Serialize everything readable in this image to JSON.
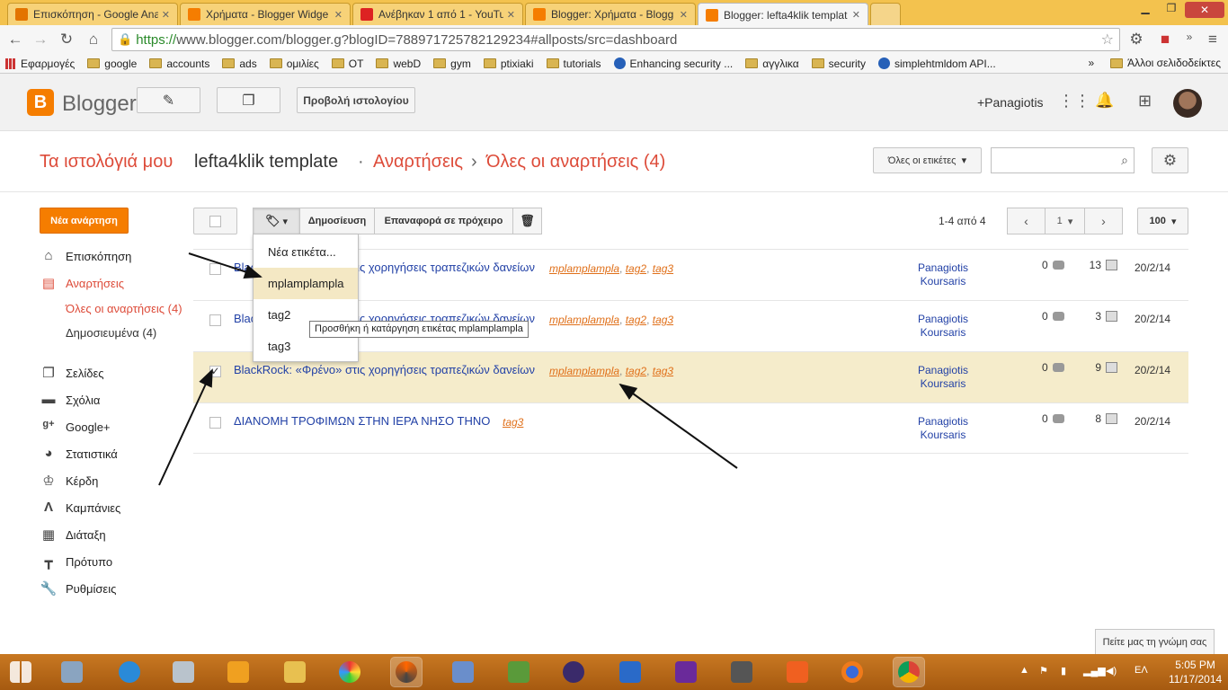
{
  "browser": {
    "tabs": [
      {
        "label": "Επισκόπηση - Google Ana",
        "color": "#e37400"
      },
      {
        "label": "Χρήματα - Blogger Widge",
        "color": "#f57d00"
      },
      {
        "label": "Ανέβηκαν 1 από 1 - YouTu",
        "color": "#d22"
      },
      {
        "label": "Blogger: Χρήματα - Blogg",
        "color": "#f57d00"
      },
      {
        "label": "Blogger: lefta4klik templat",
        "color": "#f57d00"
      }
    ],
    "url_https": "https://",
    "url_rest": "www.blogger.com/blogger.g?blogID=788971725782129234#allposts/src=dashboard",
    "bookmarks": [
      "Εφαρμογές",
      "google",
      "accounts",
      "ads",
      "ομιλίες",
      "OT",
      "webD",
      "gym",
      "ptixiaki",
      "tutorials",
      "Enhancing security ...",
      "αγγλικα",
      "security",
      "simplehtmldom API..."
    ],
    "bookmarks_more": "»",
    "other_bookmarks": "Άλλοι σελιδοδείκτες"
  },
  "header": {
    "brand": "Blogger",
    "view_blog": "Προβολή ιστολογίου",
    "user": "+Panagiotis"
  },
  "breadcrumb": {
    "my_blogs": "Τα ιστολόγιά μου",
    "blog": "lefta4klik template",
    "dot": "·",
    "posts": "Αναρτήσεις",
    "arrow": "›",
    "all_posts": "Όλες οι αναρτήσεις (4)"
  },
  "filter": {
    "labels": "Όλες οι ετικέτες"
  },
  "sidebar": {
    "new_post": "Νέα ανάρτηση",
    "items": [
      {
        "label": "Επισκόπηση",
        "icon": "home-icon"
      },
      {
        "label": "Αναρτήσεις",
        "icon": "posts-icon"
      },
      {
        "label": "Σελίδες",
        "icon": "pages-icon"
      },
      {
        "label": "Σχόλια",
        "icon": "comments-icon"
      },
      {
        "label": "Google+",
        "icon": "google-plus-icon"
      },
      {
        "label": "Στατιστικά",
        "icon": "stats-icon"
      },
      {
        "label": "Κέρδη",
        "icon": "trophy-icon"
      },
      {
        "label": "Καμπάνιες",
        "icon": "campaigns-icon"
      },
      {
        "label": "Διάταξη",
        "icon": "layout-icon"
      },
      {
        "label": "Πρότυπο",
        "icon": "template-icon"
      },
      {
        "label": "Ρυθμίσεις",
        "icon": "wrench-icon"
      }
    ],
    "sub_all": "Όλες οι αναρτήσεις (4)",
    "sub_published": "Δημοσιευμένα (4)"
  },
  "actions": {
    "publish": "Δημοσίευση",
    "revert": "Επαναφορά σε πρόχειρο",
    "pager_text": "1-4 από 4",
    "page": "1",
    "per_page": "100"
  },
  "label_menu": {
    "items": [
      "Νέα ετικέτα...",
      "mplamplampla",
      "tag2",
      "tag3"
    ],
    "tooltip": "Προσθήκη ή κατάργηση ετικέτας mplamplampla"
  },
  "posts": [
    {
      "title": "BlackRock: «Φρένο» στις χορηγήσεις τραπεζικών δανείων",
      "tags": [
        "mplamplampla",
        "tag2",
        "tag3"
      ],
      "author1": "Panagiotis",
      "author2": "Koursaris",
      "comments": "0",
      "views": "13",
      "date": "20/2/14",
      "checked": ""
    },
    {
      "title": "BlackRock: «Φρένο» στις χορηγήσεις τραπεζικών δανείων",
      "tags": [
        "mplamplampla",
        "tag2",
        "tag3"
      ],
      "author1": "Panagiotis",
      "author2": "Koursaris",
      "comments": "0",
      "views": "3",
      "date": "20/2/14",
      "checked": ""
    },
    {
      "title": "BlackRock: «Φρένο» στις χορηγήσεις τραπεζικών δανείων",
      "tags": [
        "mplamplampla",
        "tag2",
        "tag3"
      ],
      "author1": "Panagiotis",
      "author2": "Koursaris",
      "comments": "0",
      "views": "9",
      "date": "20/2/14",
      "checked": "✓"
    },
    {
      "title": "ΔΙΑΝΟΜΗ ΤΡΟΦΙΜΩΝ ΣΤΗΝ ΙΕΡΑ ΝΗΣΟ ΤΗΝΟ",
      "tags": [
        "tag3"
      ],
      "author1": "Panagiotis",
      "author2": "Koursaris",
      "comments": "0",
      "views": "8",
      "date": "20/2/14",
      "checked": ""
    }
  ],
  "feedback": "Πείτε μας τη γνώμη σας",
  "taskbar": {
    "lang": "ΕΛ",
    "time": "5:05 PM",
    "date": "11/17/2014"
  }
}
